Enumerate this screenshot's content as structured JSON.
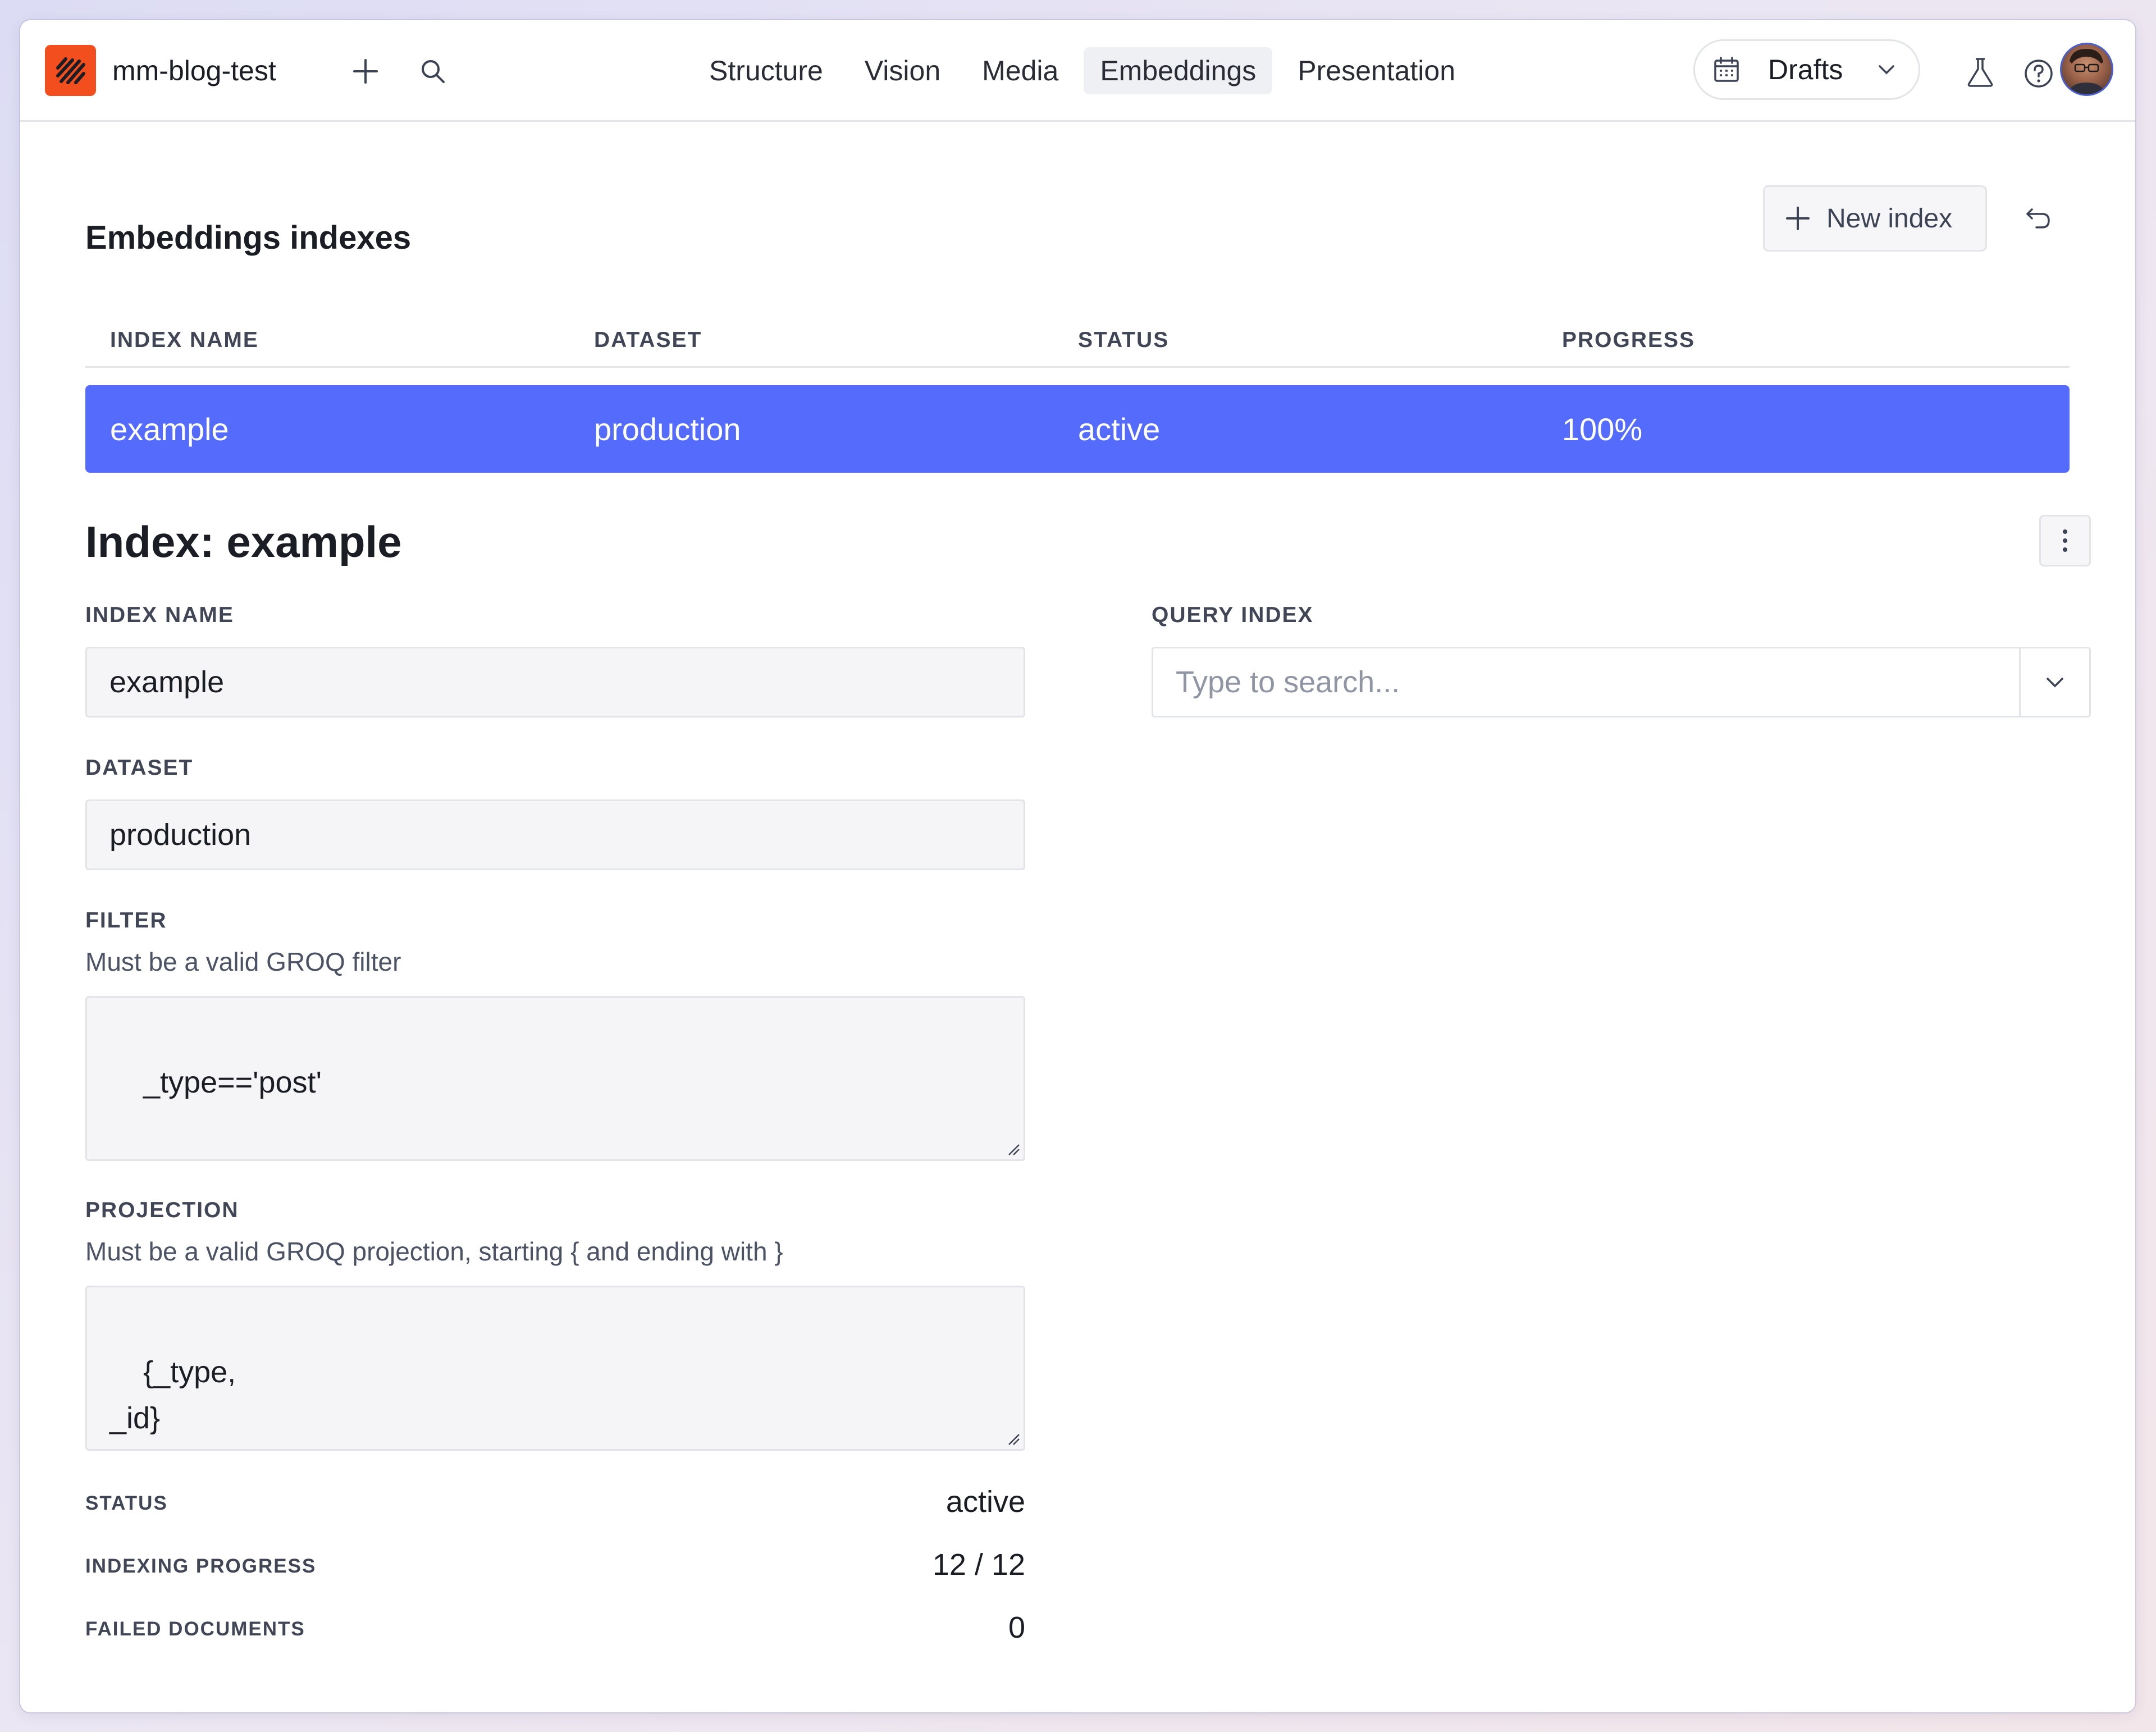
{
  "topbar": {
    "workspace_name": "mm-blog-test",
    "nav": [
      {
        "label": "Structure"
      },
      {
        "label": "Vision"
      },
      {
        "label": "Media"
      },
      {
        "label": "Embeddings",
        "active": true
      },
      {
        "label": "Presentation"
      }
    ],
    "perspective_label": "Drafts"
  },
  "indexes": {
    "title": "Embeddings indexes",
    "new_index_label": "New index",
    "columns": [
      "INDEX NAME",
      "DATASET",
      "STATUS",
      "PROGRESS"
    ],
    "rows": [
      {
        "name": "example",
        "dataset": "production",
        "status": "active",
        "progress": "100%",
        "selected": true
      }
    ]
  },
  "detail": {
    "title": "Index: example",
    "index_name_label": "INDEX NAME",
    "index_name_value": "example",
    "dataset_label": "DATASET",
    "dataset_value": "production",
    "filter_label": "FILTER",
    "filter_description": "Must be a valid GROQ filter",
    "filter_value": "_type=='post'",
    "projection_label": "PROJECTION",
    "projection_description": "Must be a valid GROQ projection, starting { and ending with }",
    "projection_value": "{_type,\n_id}",
    "query_label": "QUERY INDEX",
    "query_placeholder": "Type to search...",
    "status_label": "STATUS",
    "status_value": "active",
    "progress_label": "INDEXING PROGRESS",
    "progress_value": "12 / 12",
    "failed_label": "FAILED DOCUMENTS",
    "failed_value": "0"
  },
  "colors": {
    "accent": "#556bfc",
    "brand": "#f24e1e"
  }
}
